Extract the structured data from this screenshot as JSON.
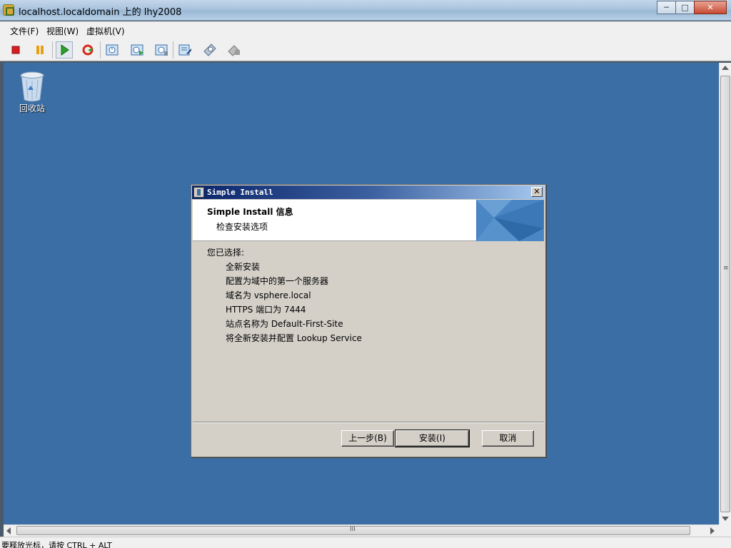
{
  "window": {
    "title": "localhost.localdomain 上的 lhy2008",
    "minimize": "─",
    "maximize": "□",
    "close": "✕"
  },
  "menu": [
    "文件(F)",
    "视图(W)",
    "虚拟机(V)"
  ],
  "toolbar": {
    "icons": [
      "stop-icon",
      "pause-icon",
      "play-icon",
      "reset-icon",
      "snapshot-icon",
      "revert-snapshot-icon",
      "manage-snapshots-icon",
      "edit-settings-icon",
      "connect-cd-icon",
      "connect-floppy-icon"
    ],
    "colors": {
      "stop": "#d91c1c",
      "pause": "#e8a012",
      "play": "#2aa12a",
      "reset": "#d82a1a"
    }
  },
  "desktop": {
    "recycle_bin_label": "回收站",
    "background": "#3b6ea5"
  },
  "dialog": {
    "title": "Simple Install",
    "close": "✕",
    "heading": "Simple Install 信息",
    "subheading": "检查安装选项",
    "summary_label": "您已选择:",
    "summary_items": [
      "全新安装",
      "配置为域中的第一个服务器",
      "域名为 vsphere.local",
      "HTTPS 端口为 7444",
      "站点名称为 Default-First-Site",
      "将全新安装并配置 Lookup Service"
    ],
    "buttons": {
      "back": "上一步(B)",
      "install": "安装(I)",
      "cancel": "取消"
    }
  },
  "scrollbar": {
    "grip": "III",
    "vgrip": "≡"
  },
  "status": "要释放光标，请按 CTRL + ALT"
}
